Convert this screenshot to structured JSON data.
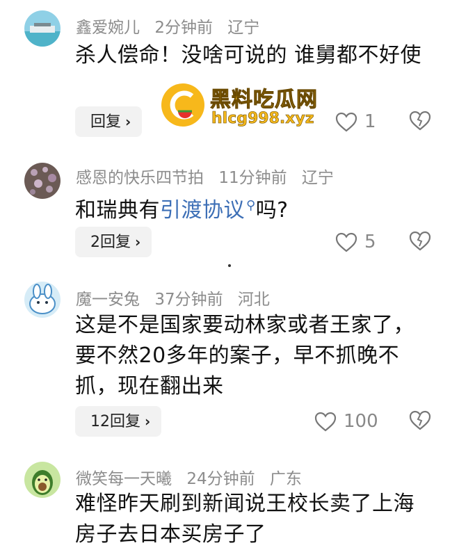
{
  "comments": [
    {
      "user": "鑫爱婉儿",
      "time": "2分钟前",
      "location": "辽宁",
      "text": "杀人偿命！没啥可说的 谁舅都不好使",
      "reply": "回复",
      "likes": "1"
    },
    {
      "user": "感恩的快乐四节拍",
      "time": "11分钟前",
      "location": "辽宁",
      "text_prefix": "和瑞典有",
      "text_link": "引渡协议",
      "text_suffix": "吗?",
      "reply": "2回复",
      "likes": "5"
    },
    {
      "user": "魔一安兔",
      "time": "37分钟前",
      "location": "河北",
      "text": "这是不是国家要动林家或者王家了，要不然20多年的案子，早不抓晚不抓，现在翻出来",
      "reply": "12回复",
      "likes": "100"
    },
    {
      "user": "微笑每一天曦",
      "time": "24分钟前",
      "location": "广东",
      "text": "难怪昨天刷到新闻说王校长卖了上海房子去日本买房子了"
    }
  ],
  "watermark": {
    "title": "黑料吃瓜网",
    "site": "hlcg998.xyz"
  },
  "icons": {
    "like": "heart-outline-icon",
    "dislike": "broken-heart-icon",
    "reply_chevron": "chevron-right-icon"
  }
}
